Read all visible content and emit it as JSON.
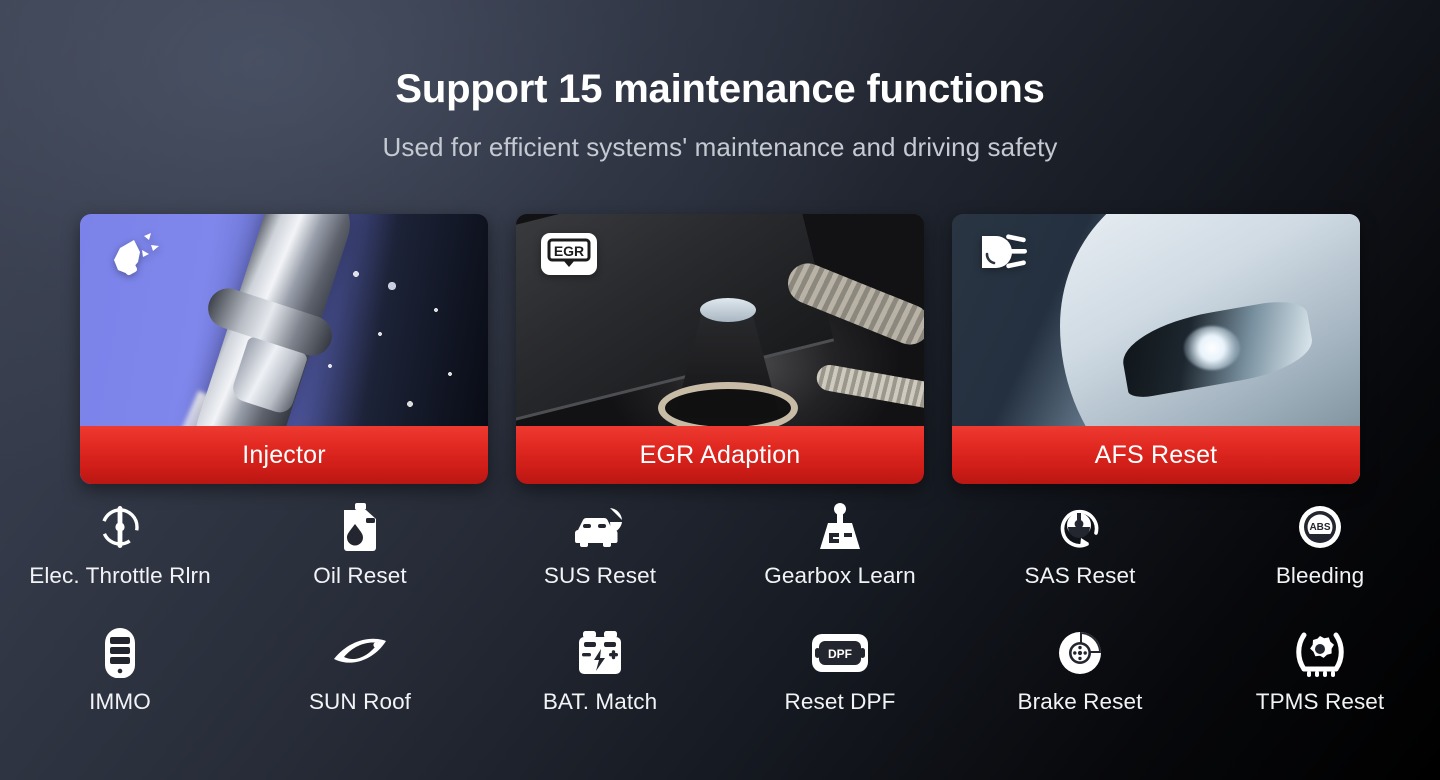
{
  "header": {
    "title": "Support 15 maintenance functions",
    "subtitle": "Used for efficient systems' maintenance and driving safety"
  },
  "colors": {
    "accent_red_top": "#ee3a30",
    "accent_red_bottom": "#b91713",
    "background_light": "#3d4352",
    "background_dark": "#000000",
    "label_text": "#ffffff",
    "subtitle_text": "#c4c9d2"
  },
  "cards": [
    {
      "label": "Injector",
      "icon": "injector-spray-icon",
      "photo": "fuel-injector-spray-photo"
    },
    {
      "label": "EGR Adaption",
      "icon": "egr-badge-icon",
      "photo": "engine-bay-egr-valve-photo"
    },
    {
      "label": "AFS Reset",
      "icon": "headlamp-beam-icon",
      "photo": "car-headlight-photo"
    }
  ],
  "functions": [
    {
      "label": "Elec. Throttle Rlrn",
      "icon": "throttle-body-icon"
    },
    {
      "label": "Oil Reset",
      "icon": "oil-can-icon"
    },
    {
      "label": "SUS Reset",
      "icon": "suspension-car-icon"
    },
    {
      "label": "Gearbox Learn",
      "icon": "gear-shifter-icon"
    },
    {
      "label": "SAS Reset",
      "icon": "steering-angle-sensor-icon"
    },
    {
      "label": "Bleeding",
      "icon": "abs-badge-icon"
    },
    {
      "label": "IMMO",
      "icon": "key-fob-icon"
    },
    {
      "label": "SUN Roof",
      "icon": "sunroof-panel-icon"
    },
    {
      "label": "BAT. Match",
      "icon": "battery-icon"
    },
    {
      "label": "Reset DPF",
      "icon": "dpf-badge-icon"
    },
    {
      "label": "Brake Reset",
      "icon": "brake-disc-icon"
    },
    {
      "label": "TPMS Reset",
      "icon": "tire-pressure-icon"
    }
  ]
}
